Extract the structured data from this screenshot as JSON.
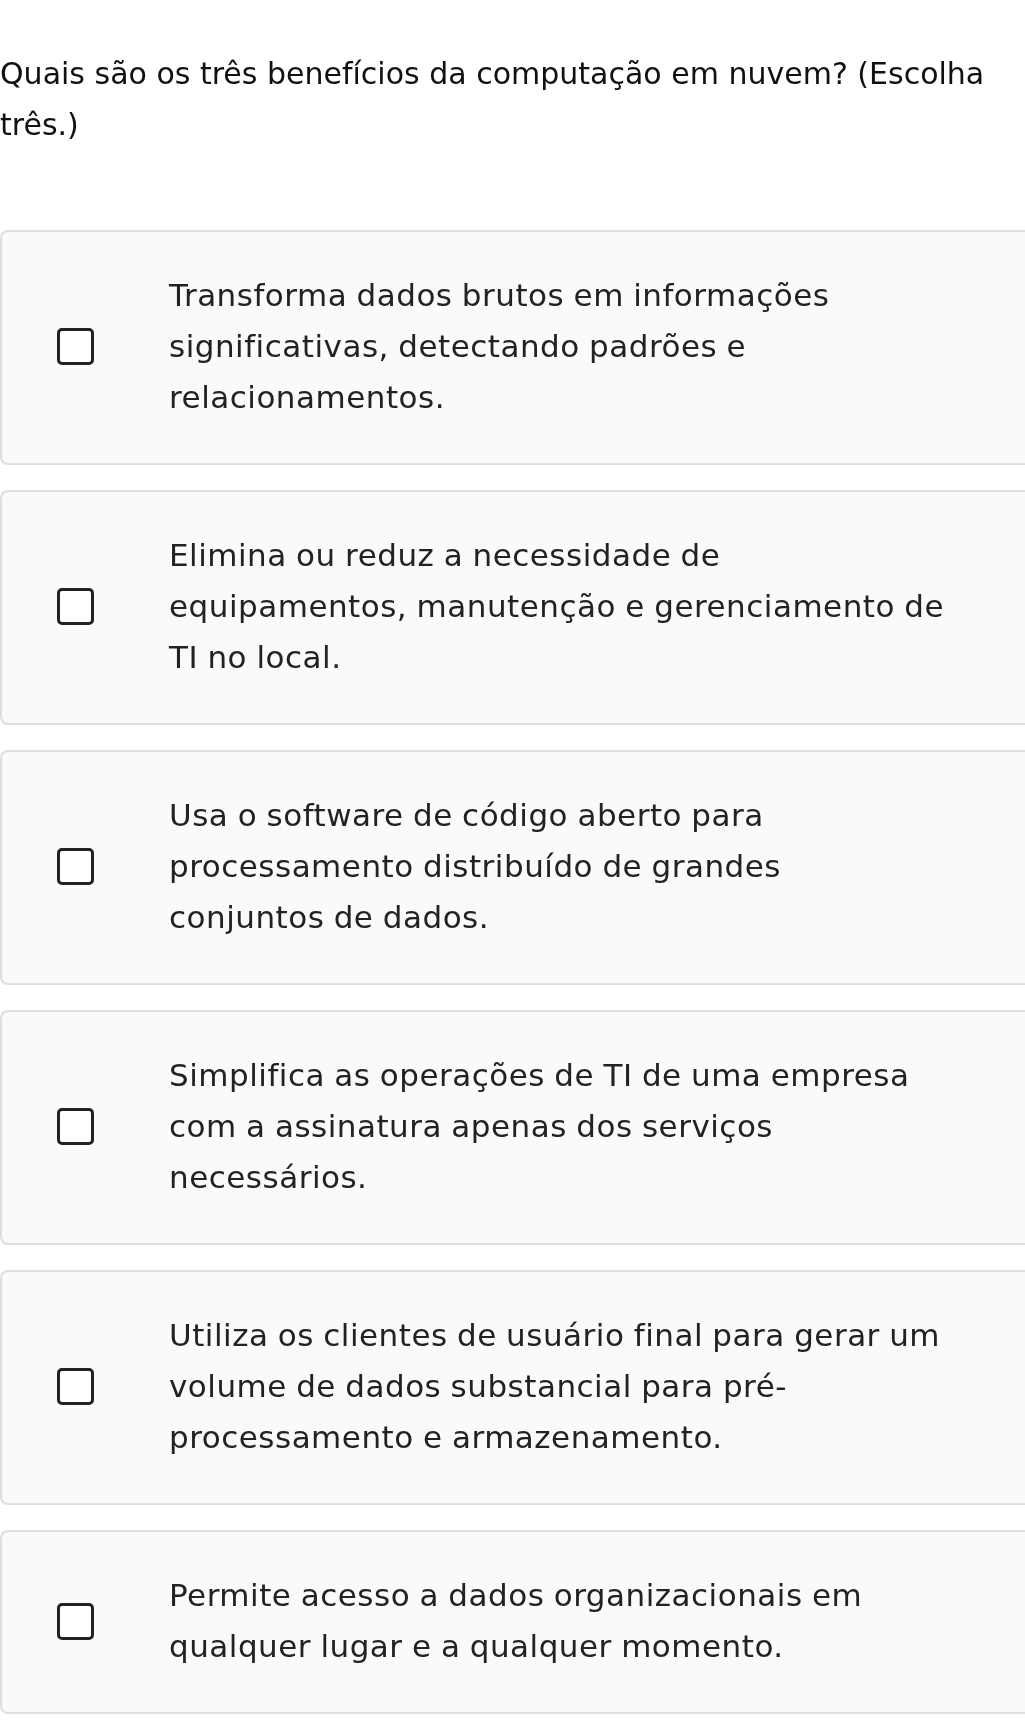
{
  "question": "Quais são os três benefícios da computação em nuvem? (Escolha três.)",
  "options": [
    {
      "text": "Transforma dados brutos em informações significativas, detectando padrões e relacionamentos.",
      "checked": false
    },
    {
      "text": "Elimina ou reduz a necessidade de equipamentos, manutenção e gerenciamento de TI no local.",
      "checked": false
    },
    {
      "text": "Usa o software de código aberto para processamento distribuído de grandes conjuntos de dados.",
      "checked": false
    },
    {
      "text": "Simplifica as operações de TI de uma empresa com a assinatura apenas dos serviços necessários.",
      "checked": false
    },
    {
      "text": "Utiliza os clientes de usuário final para gerar um volume de dados substancial para pré-processamento e armazenamento.",
      "checked": false
    },
    {
      "text": "Permite acesso a dados organizacionais em qualquer lugar e a qualquer momento.",
      "checked": false
    }
  ]
}
